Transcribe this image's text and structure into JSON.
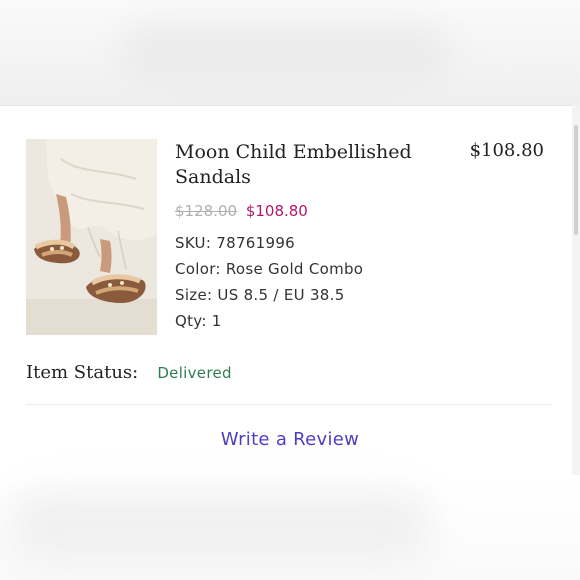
{
  "product": {
    "title": "Moon Child Embellished Sandals",
    "line_price": "$108.80",
    "original_price": "$128.00",
    "sale_price": "$108.80",
    "sku": "SKU: 78761996",
    "color": "Color: Rose Gold Combo",
    "size": "Size: US 8.5 / EU 38.5",
    "qty": "Qty: 1"
  },
  "status": {
    "label": "Item Status:",
    "value": "Delivered",
    "value_color": "#2e7d52"
  },
  "actions": {
    "review_label": "Write a Review",
    "review_color": "#4d3fbf"
  },
  "accent": {
    "sale_color": "#b2186e"
  }
}
